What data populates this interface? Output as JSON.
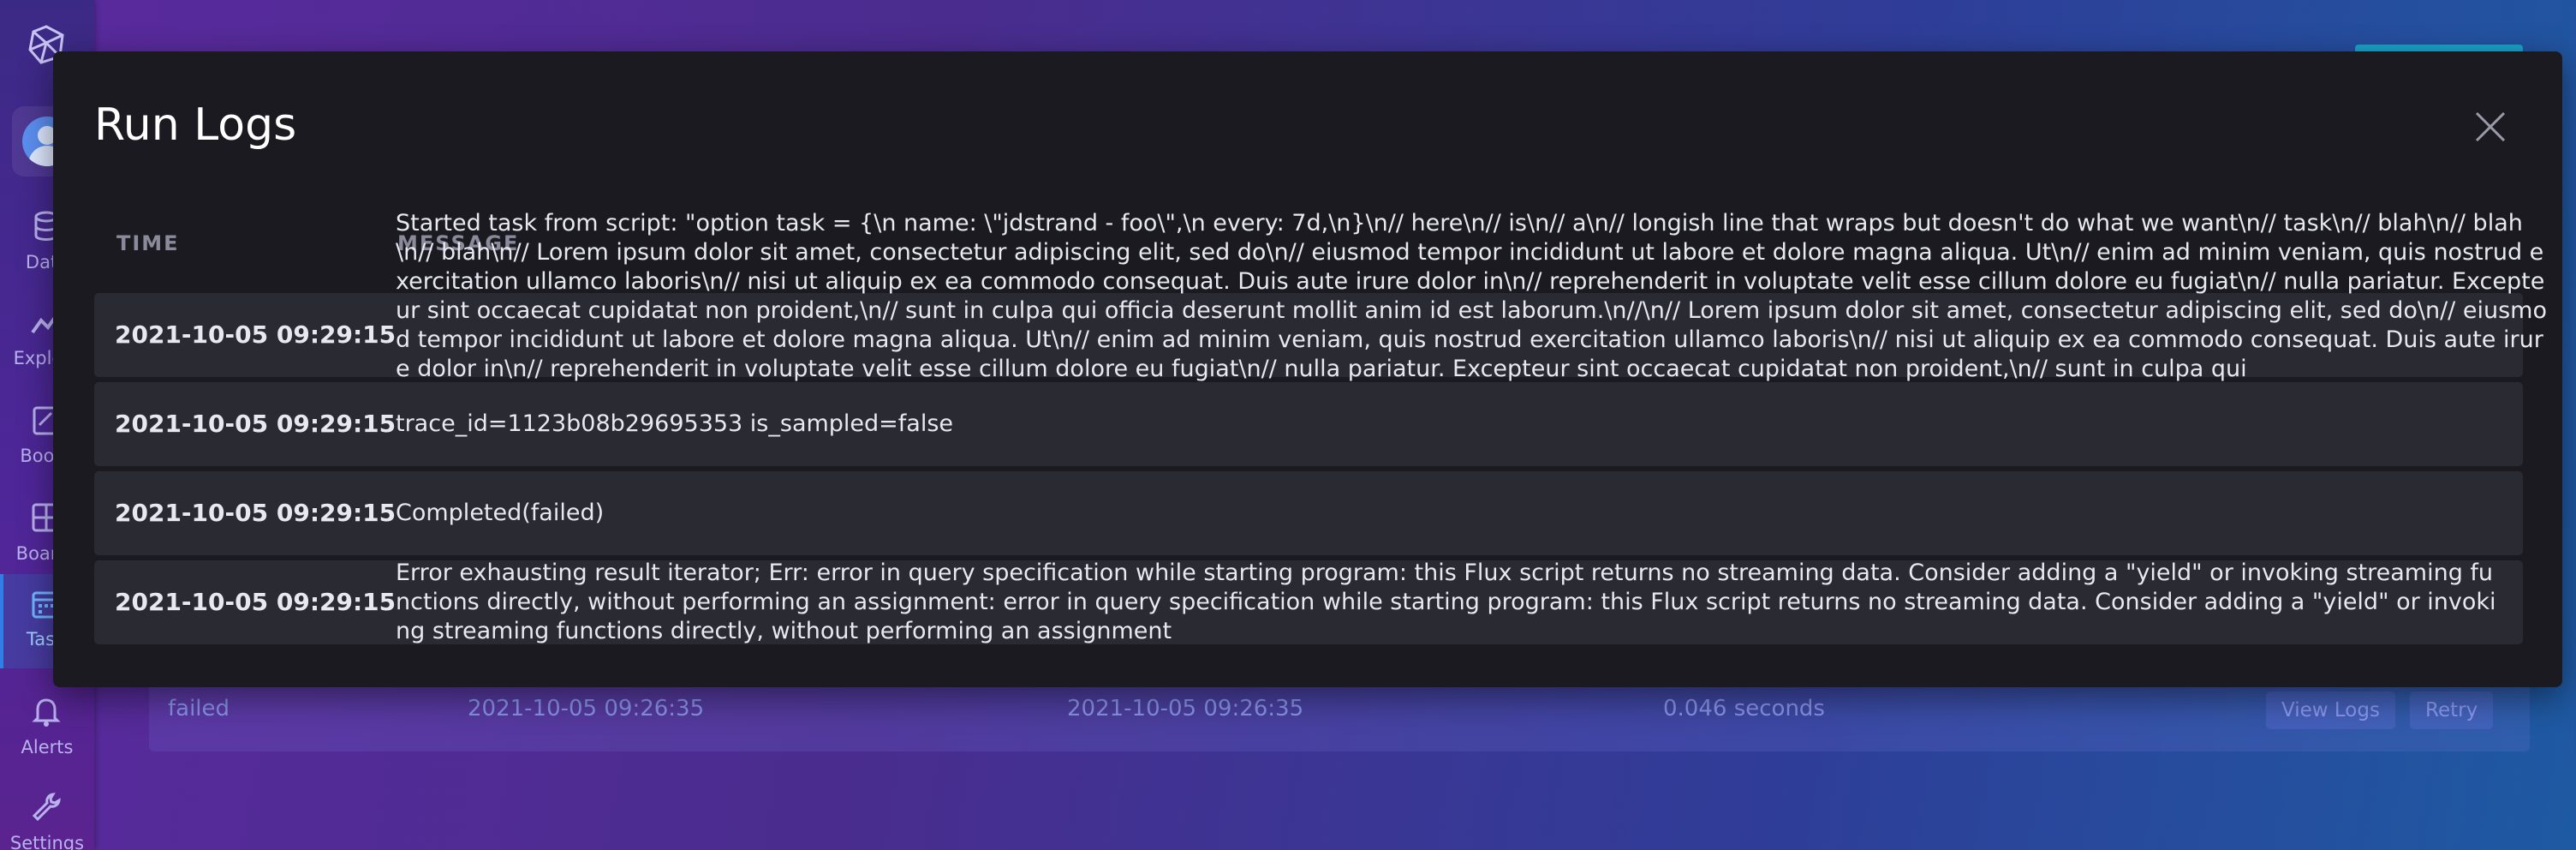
{
  "nav": {
    "items": [
      {
        "label": "Data"
      },
      {
        "label": "Explore"
      },
      {
        "label": "Books"
      },
      {
        "label": "Boards"
      },
      {
        "label": "Tasks"
      },
      {
        "label": "Alerts"
      },
      {
        "label": "Settings"
      }
    ]
  },
  "background_row": {
    "status": "failed",
    "scheduled_for": "2021-10-05 09:26:35",
    "started_at": "2021-10-05 09:26:35",
    "duration": "0.046 seconds",
    "view_logs_label": "View Logs",
    "retry_label": "Retry"
  },
  "modal": {
    "title": "Run Logs",
    "columns": {
      "time": "TIME",
      "message": "MESSAGE"
    },
    "logs": [
      {
        "time": "2021-10-05 09:29:15",
        "message": "Started task from script: \"option task = {\\n    name: \\\"jdstrand - foo\\\",\\n    every: 7d,\\n}\\n// here\\n// is\\n// a\\n// longish line that wraps but doesn't do what we want\\n// task\\n// blah\\n// blah\\n// blah\\n// Lorem ipsum dolor sit amet, consectetur adipiscing elit, sed do\\n// eiusmod tempor incididunt ut labore et dolore magna aliqua. Ut\\n// enim ad minim veniam, quis nostrud exercitation ullamco laboris\\n// nisi ut aliquip ex ea commodo consequat. Duis aute irure dolor in\\n// reprehenderit in voluptate velit esse cillum dolore eu fugiat\\n// nulla pariatur. Excepteur sint occaecat cupidatat non proident,\\n// sunt in culpa qui officia deserunt mollit anim id est laborum.\\n//\\n// Lorem ipsum dolor sit amet, consectetur adipiscing elit, sed do\\n// eiusmod tempor incididunt ut labore et dolore magna aliqua. Ut\\n// enim ad minim veniam, quis nostrud exercitation ullamco laboris\\n// nisi ut aliquip ex ea commodo consequat. Duis aute irure dolor in\\n// reprehenderit in voluptate velit esse cillum dolore eu fugiat\\n// nulla pariatur. Excepteur sint occaecat cupidatat non proident,\\n// sunt in culpa qui"
      },
      {
        "time": "2021-10-05 09:29:15",
        "message": "trace_id=1123b08b29695353 is_sampled=false"
      },
      {
        "time": "2021-10-05 09:29:15",
        "message": "Completed(failed)"
      },
      {
        "time": "2021-10-05 09:29:15",
        "message": "Error exhausting result iterator; Err: error in query specification while starting program: this Flux script returns no streaming data. Consider adding a \"yield\" or invoking streaming functions directly, without performing an assignment: error in query specification while starting program: this Flux script returns no streaming data. Consider adding a \"yield\" or invoking streaming functions directly, without performing an assignment"
      }
    ]
  },
  "icons": {
    "logo": "influx-logo-icon",
    "close": "close-icon",
    "data": "database-icon",
    "explore": "graph-icon",
    "books": "notebook-icon",
    "boards": "dashboard-icon",
    "tasks": "calendar-icon",
    "alerts": "bell-icon",
    "settings": "wrench-icon"
  }
}
